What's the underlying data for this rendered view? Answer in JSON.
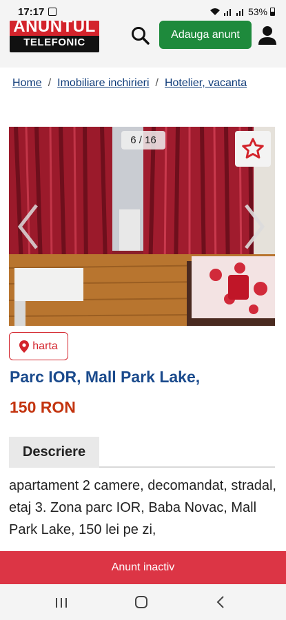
{
  "status": {
    "time": "17:17",
    "battery": "53%"
  },
  "header": {
    "logo_top": "ANUNTUL",
    "logo_bottom": "TELEFONIC",
    "add_button": "Adauga anunt"
  },
  "breadcrumb": [
    {
      "label": "Home"
    },
    {
      "label": "Imobiliare inchirieri"
    },
    {
      "label": "Hotelier, vacanta"
    }
  ],
  "breadcrumb_separator": "/",
  "gallery": {
    "counter": "6 / 16",
    "current": 6,
    "total": 16
  },
  "map_button": "harta",
  "listing": {
    "title": "Parc IOR, Mall Park Lake,",
    "price": "150 RON"
  },
  "tabs": {
    "description": "Descriere"
  },
  "description": "apartament 2 camere, decomandat, stradal, etaj 3. Zona parc IOR, Baba Novac, Mall Park Lake, 150 lei pe zi,",
  "footer": {
    "inactive_label": "Anunt inactiv"
  },
  "colors": {
    "brand_red": "#d3242c",
    "add_green": "#1e8a3c",
    "title_blue": "#1a4a8c",
    "price_orange": "#c3340f",
    "inactive_red": "#dc3545"
  }
}
